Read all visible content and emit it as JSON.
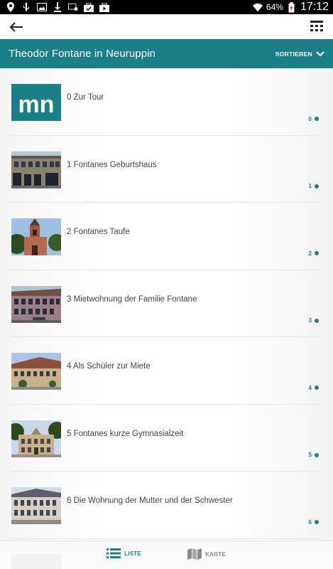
{
  "status_bar": {
    "battery_percent": "64%",
    "time": "17:12",
    "icons": [
      "location-icon",
      "usb-icon",
      "image-icon",
      "download-icon",
      "cast-icon",
      "briefcase-check-icon",
      "briefcase-play-icon",
      "wifi-icon",
      "battery-icon"
    ]
  },
  "toolbar": {
    "back_icon": "arrow-left-icon",
    "filter_icon": "filter-grid-icon"
  },
  "header": {
    "title": "Theodor Fontane in Neuruppin",
    "sort_label": "SORTIEREN"
  },
  "list": {
    "items": [
      {
        "title": "0 Zur Tour",
        "count": "0",
        "thumb": "mn-logo"
      },
      {
        "title": "1 Fontanes Geburtshaus",
        "count": "1",
        "thumb": "building-photo"
      },
      {
        "title": "2 Fontanes Taufe",
        "count": "2",
        "thumb": "church-photo"
      },
      {
        "title": "3 Mietwohnung der Familie Fontane",
        "count": "3",
        "thumb": "building-photo"
      },
      {
        "title": "4 Als Schüler zur Miete",
        "count": "4",
        "thumb": "building-photo"
      },
      {
        "title": "5 Fontanes kurze Gymnasialzeit",
        "count": "5",
        "thumb": "school-photo"
      },
      {
        "title": "6 Die Wohnung der Mutter und der Schwester",
        "count": "6",
        "thumb": "building-photo"
      }
    ]
  },
  "thumbnail_logo": {
    "text": "mn"
  },
  "bottom_nav": {
    "list_label": "LISTE",
    "map_label": "KARTE"
  },
  "colors": {
    "accent": "#1a7f87",
    "header_bg": "#1a7f87",
    "status_bar": "#000000"
  }
}
